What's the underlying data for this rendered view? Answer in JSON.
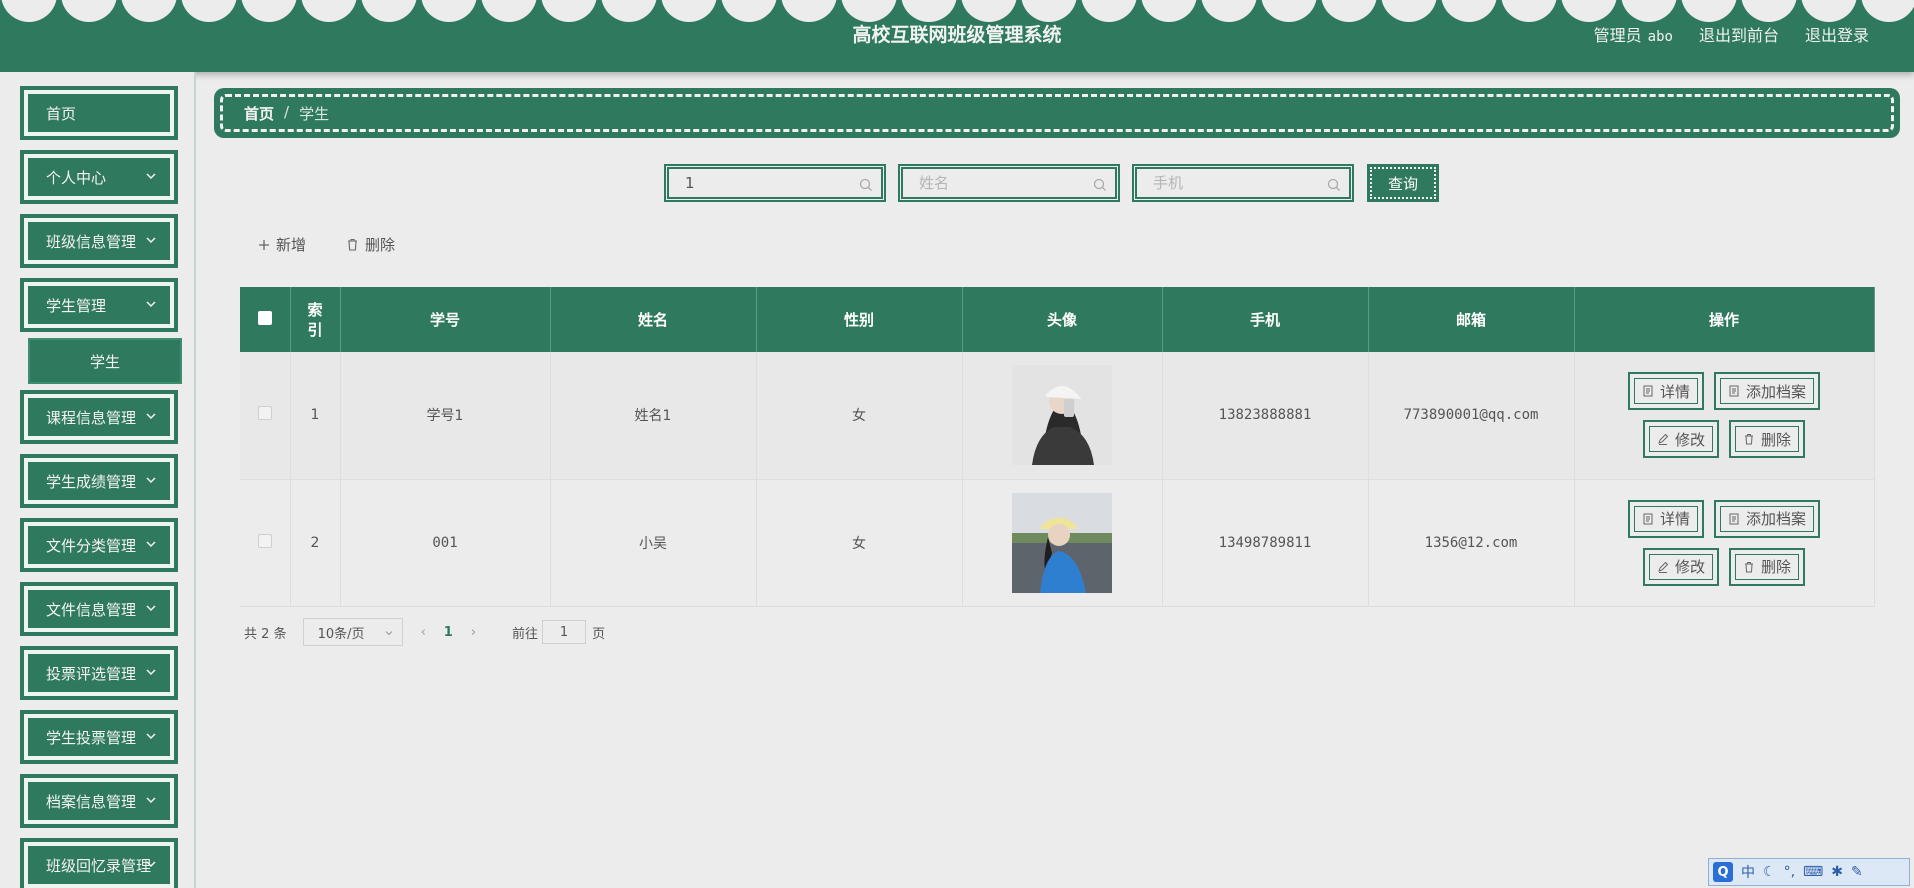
{
  "header": {
    "title": "高校互联网班级管理系统",
    "admin_label": "管理员",
    "admin_user": "abo",
    "front_link": "退出到前台",
    "logout_link": "退出登录"
  },
  "sidebar": {
    "items": [
      {
        "label": "首页"
      },
      {
        "label": "个人中心"
      },
      {
        "label": "班级信息管理"
      },
      {
        "label": "学生管理"
      },
      {
        "label": "课程信息管理"
      },
      {
        "label": "学生成绩管理"
      },
      {
        "label": "文件分类管理"
      },
      {
        "label": "文件信息管理"
      },
      {
        "label": "投票评选管理"
      },
      {
        "label": "学生投票管理"
      },
      {
        "label": "档案信息管理"
      },
      {
        "label": "班级回忆录管理"
      }
    ],
    "submenu_active": "学生"
  },
  "breadcrumb": {
    "home": "首页",
    "separator": "/",
    "current": "学生"
  },
  "search": {
    "student_no_value": "1",
    "name_placeholder": "姓名",
    "phone_placeholder": "手机",
    "query_label": "查询"
  },
  "actions": {
    "add_label": "新增",
    "delete_label": "删除"
  },
  "table": {
    "headers": [
      "索引",
      "学号",
      "姓名",
      "性别",
      "头像",
      "手机",
      "邮箱",
      "操作"
    ],
    "rows": [
      {
        "index": "1",
        "student_no": "学号1",
        "name": "姓名1",
        "gender": "女",
        "phone": "13823888881",
        "email": "773890001@qq.com"
      },
      {
        "index": "2",
        "student_no": "001",
        "name": "小吴",
        "gender": "女",
        "phone": "13498789811",
        "email": "1356@12.com"
      }
    ],
    "op_labels": {
      "detail": "详情",
      "archive": "添加档案",
      "edit": "修改",
      "delete": "删除"
    }
  },
  "pagination": {
    "total_prefix": "共",
    "total": "2",
    "total_suffix": "条",
    "page_size": "10条/页",
    "current_page": "1",
    "goto_label": "前往",
    "goto_value": "1",
    "page_unit": "页"
  },
  "ime": {
    "mode": "中"
  },
  "colors": {
    "primary": "#2f7a5e",
    "background": "#ececec"
  }
}
